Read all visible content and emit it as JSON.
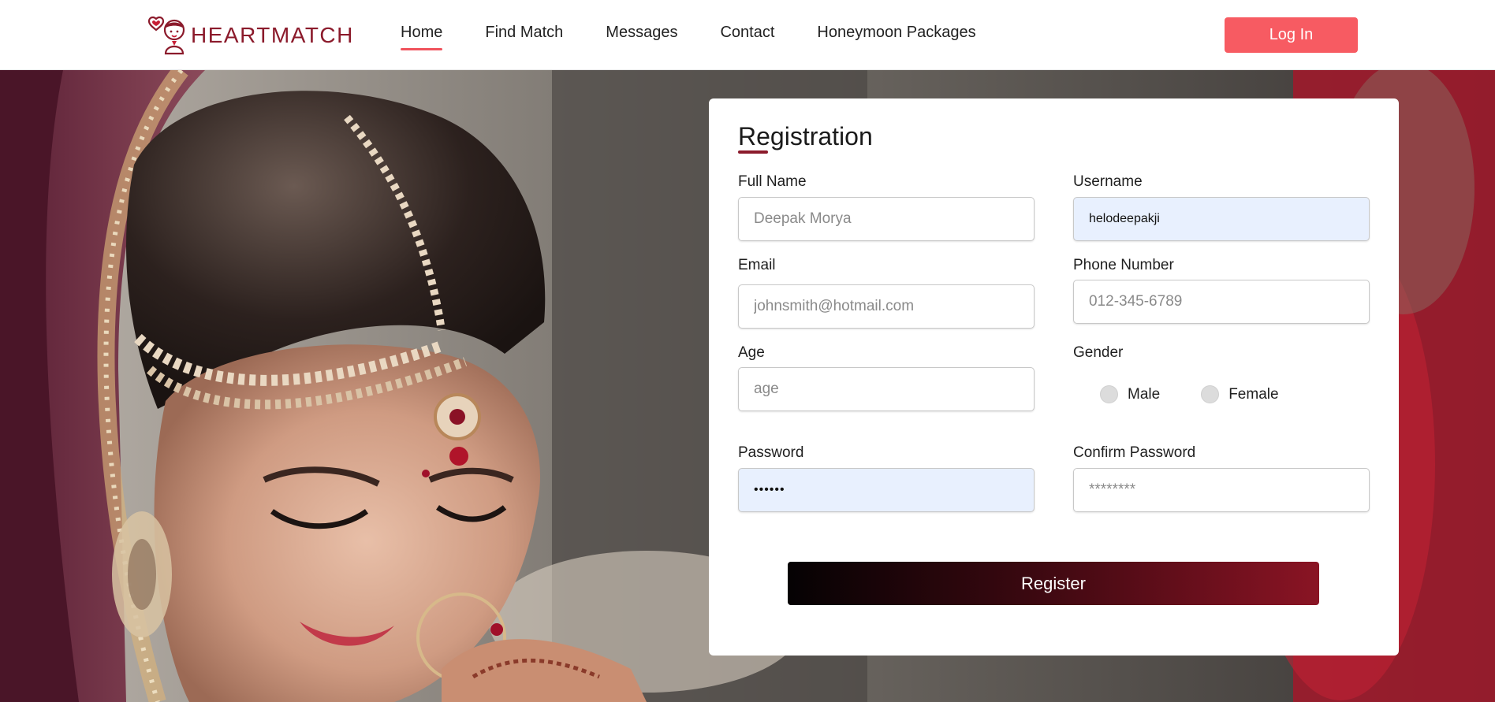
{
  "brand": {
    "name": "HEARTMATCH",
    "color": "#8b1a2b"
  },
  "nav": {
    "links": [
      {
        "label": "Home",
        "active": true
      },
      {
        "label": "Find Match",
        "active": false
      },
      {
        "label": "Messages",
        "active": false
      },
      {
        "label": "Contact",
        "active": false
      },
      {
        "label": "Honeymoon Packages",
        "active": false
      }
    ],
    "login_label": "Log In",
    "accent_color": "#f75b62"
  },
  "registration": {
    "title": "Registration",
    "full_name": {
      "label": "Full Name",
      "placeholder": "Deepak Morya",
      "value": ""
    },
    "username": {
      "label": "Username",
      "placeholder": "",
      "value": "helodeepakji"
    },
    "email": {
      "label": "Email",
      "placeholder": "johnsmith@hotmail.com",
      "value": ""
    },
    "phone": {
      "label": "Phone Number",
      "placeholder": "012-345-6789",
      "value": ""
    },
    "age": {
      "label": "Age",
      "placeholder": "age",
      "value": ""
    },
    "gender": {
      "label": "Gender",
      "options": [
        "Male",
        "Female"
      ]
    },
    "password": {
      "label": "Password",
      "placeholder": "",
      "value": "••••••"
    },
    "confirm_password": {
      "label": "Confirm Password",
      "placeholder": "********",
      "value": ""
    },
    "register_label": "Register"
  }
}
